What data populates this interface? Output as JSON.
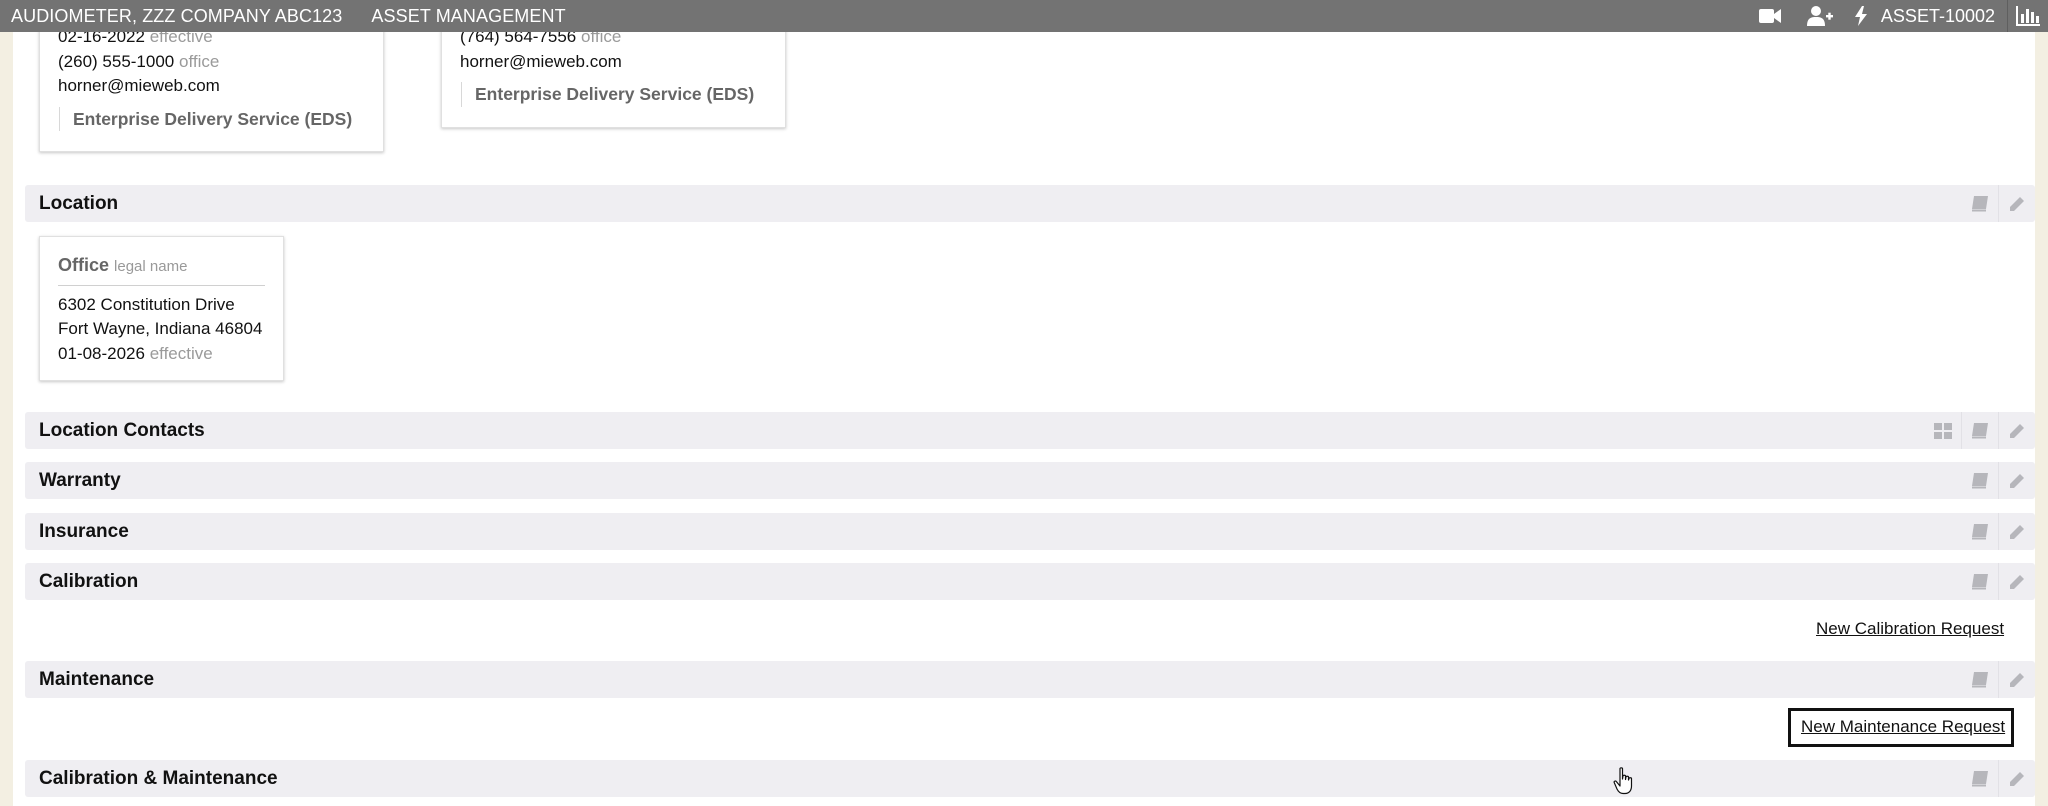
{
  "topbar": {
    "title": "AUDIOMETER, ZZZ COMPANY ABC123",
    "module": "ASSET MANAGEMENT",
    "asset_id": "ASSET-10002",
    "icons": [
      "video-icon",
      "add-user-icon",
      "bolt-icon",
      "bar-chart-icon"
    ]
  },
  "contacts": [
    {
      "date": "02-16-2022",
      "date_label": "effective",
      "phone": "(260) 555-1000",
      "phone_label": "office",
      "email": "horner@mieweb.com",
      "org": "Enterprise Delivery Service (EDS)"
    },
    {
      "phone": "(764) 564-7556",
      "phone_label": "office",
      "email": "horner@mieweb.com",
      "org": "Enterprise Delivery Service (EDS)"
    }
  ],
  "location_card": {
    "name": "Office",
    "name_label": "legal name",
    "street": "6302 Constitution Drive",
    "city_line": "Fort Wayne, Indiana 46804",
    "date": "01-08-2026",
    "date_label": "effective"
  },
  "sections": {
    "location": "Location",
    "location_contacts": "Location Contacts",
    "warranty": "Warranty",
    "insurance": "Insurance",
    "calibration": "Calibration",
    "maintenance": "Maintenance",
    "cal_maint": "Calibration & Maintenance"
  },
  "links": {
    "new_calibration": "New Calibration Request",
    "new_maintenance": "New Maintenance Request"
  },
  "colors": {
    "topbar": "#737373",
    "page_bg": "#f3efe2",
    "section_bg": "#efeef2",
    "muted_text": "#9a9a9a"
  }
}
